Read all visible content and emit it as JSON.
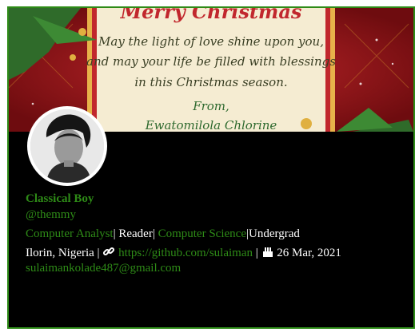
{
  "banner": {
    "title": "Merry Christmas",
    "line1": "May the light of love shine upon you,",
    "line2": "and may your life be filled with blessings",
    "line3": "in this Christmas season.",
    "from": "From,",
    "signature": "Ewatomilola Chlorine"
  },
  "profile": {
    "name": "Classical Boy",
    "handle": "@themmy",
    "role1": "Computer Analyst",
    "role2": "Reader",
    "role3": "Computer Science",
    "role4": "Undergrad",
    "location": "Ilorin, Nigeria |",
    "link": "https://github.com/sulaiman",
    "separator": "|",
    "birthday": "26 Mar, 2021",
    "email": "sulaimankolade487@gmail.com"
  },
  "icons": {
    "link": "link-icon",
    "birthday": "birthday-cake-icon"
  },
  "colors": {
    "accent_green": "#2e8b17",
    "card_background": "#000000"
  }
}
